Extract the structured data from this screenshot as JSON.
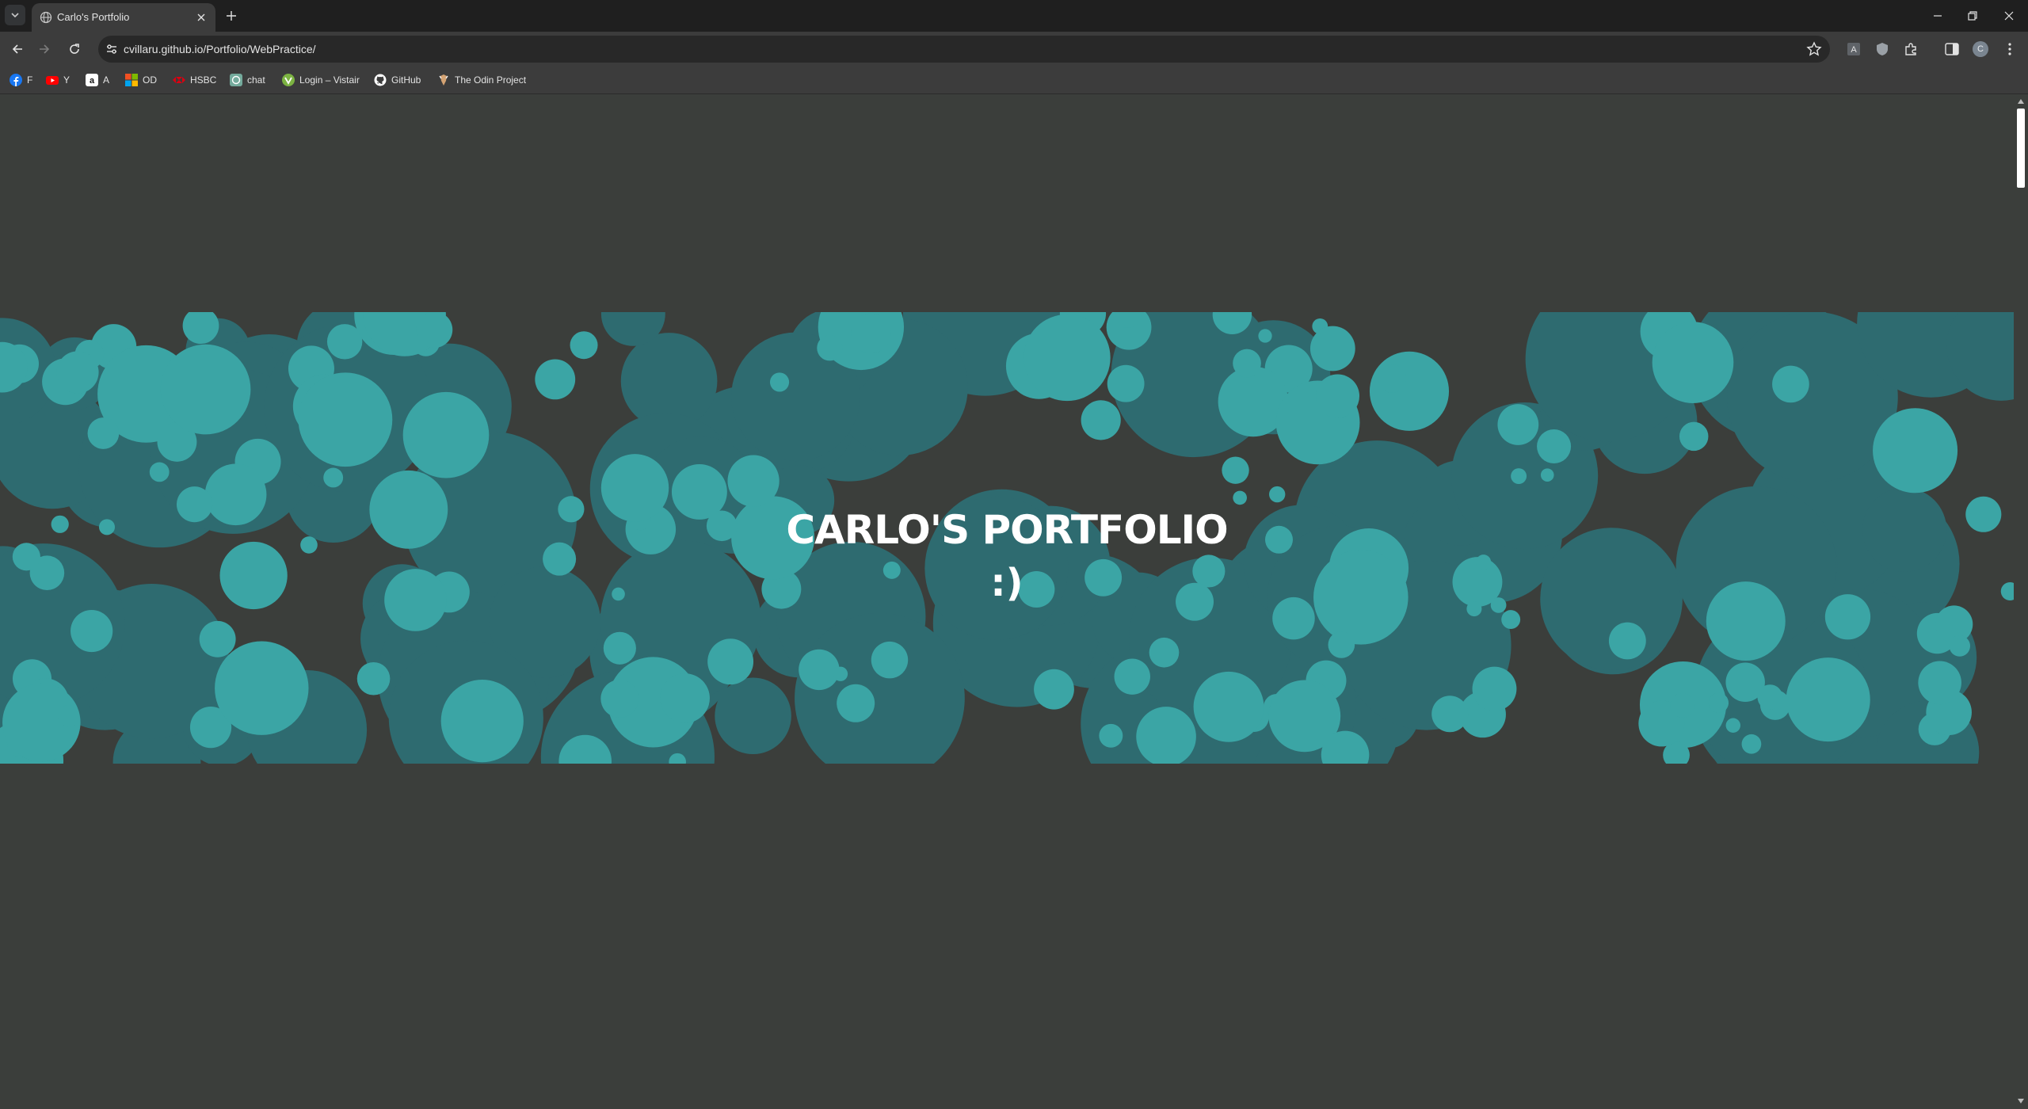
{
  "browser": {
    "tab": {
      "title": "Carlo's Portfolio"
    },
    "omnibox": {
      "url": "cvillaru.github.io/Portfolio/WebPractice/"
    },
    "profile_initial": "C",
    "bookmarks": [
      {
        "label": "F",
        "icon": "facebook-icon",
        "color": "#1877f2"
      },
      {
        "label": "Y",
        "icon": "youtube-icon",
        "color": "#ff0000"
      },
      {
        "label": "A",
        "icon": "amazon-icon",
        "color": "#ffffff"
      },
      {
        "label": "OD",
        "icon": "microsoft-icon",
        "color": "#f25022"
      },
      {
        "label": "HSBC",
        "icon": "hsbc-icon",
        "color": "#db0011"
      },
      {
        "label": "chat",
        "icon": "chat-icon",
        "color": "#74aa9c"
      },
      {
        "label": "Login – Vistair",
        "icon": "vistair-icon",
        "color": "#7cb342"
      },
      {
        "label": "GitHub",
        "icon": "github-icon",
        "color": "#ffffff"
      },
      {
        "label": "The Odin Project",
        "icon": "odin-icon",
        "color": "#d4a373"
      }
    ]
  },
  "hero": {
    "title": "CARLO'S PORTFOLIO",
    "subtitle": ":)"
  },
  "colors": {
    "page_bg": "#3b3e3b",
    "bubble_dark": "#2e6b70",
    "bubble_light": "#3ba5a5"
  }
}
